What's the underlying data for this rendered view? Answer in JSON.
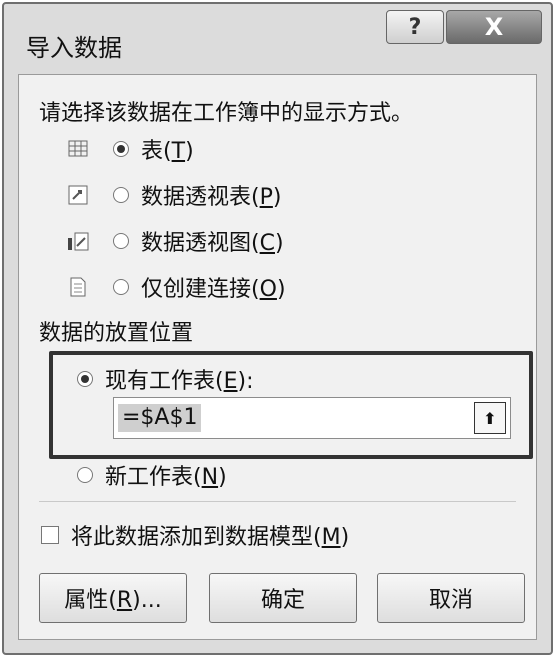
{
  "dialog": {
    "title": "导入数据",
    "help_glyph": "?",
    "close_glyph": "X",
    "prompt": "请选择该数据在工作簿中的显示方式。",
    "view_options": [
      {
        "text": "表",
        "key": "T",
        "selected": true,
        "icon": "table-icon"
      },
      {
        "text": "数据透视表",
        "key": "P",
        "selected": false,
        "icon": "pivot-table-icon"
      },
      {
        "text": "数据透视图",
        "key": "C",
        "selected": false,
        "icon": "pivot-chart-icon"
      },
      {
        "text": "仅创建连接",
        "key": "O",
        "selected": false,
        "icon": "connection-only-icon"
      }
    ],
    "placement_label": "数据的放置位置",
    "placement_options": [
      {
        "text": "现有工作表",
        "key": "E",
        "suffix": ":",
        "selected": true
      },
      {
        "text": "新工作表",
        "key": "N",
        "suffix": "",
        "selected": false
      }
    ],
    "reference_value": "=$A$1",
    "collapse_glyph": "⬆",
    "data_model_checkbox": {
      "text": "将此数据添加到数据模型",
      "key": "M",
      "checked": false
    },
    "buttons": {
      "properties": {
        "text": "属性",
        "key": "R",
        "suffix": "..."
      },
      "ok": "确定",
      "cancel": "取消"
    }
  }
}
